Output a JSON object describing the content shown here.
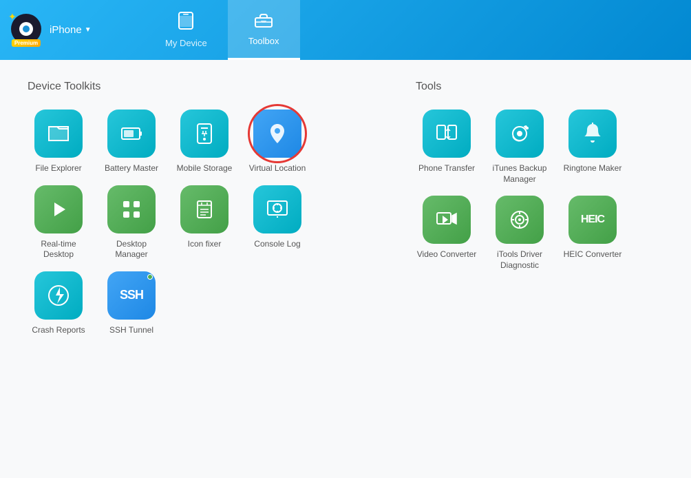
{
  "header": {
    "logo": "👁",
    "device": "iPhone",
    "premium": "Premium",
    "tabs": [
      {
        "id": "my-device",
        "label": "My Device",
        "icon": "📱",
        "active": false
      },
      {
        "id": "toolbox",
        "label": "Toolbox",
        "icon": "🧰",
        "active": true
      }
    ],
    "controls": [
      "☰",
      "—",
      "□",
      "✕"
    ]
  },
  "device_toolkits": {
    "section_title": "Device Toolkits",
    "tools": [
      {
        "id": "file-explorer",
        "label": "File Explorer",
        "icon": "folder",
        "color": "teal"
      },
      {
        "id": "battery-master",
        "label": "Battery Master",
        "icon": "battery",
        "color": "teal"
      },
      {
        "id": "mobile-storage",
        "label": "Mobile Storage",
        "icon": "storage",
        "color": "teal"
      },
      {
        "id": "virtual-location",
        "label": "Virtual Location",
        "icon": "location",
        "color": "blue-outlined"
      },
      {
        "id": "real-time-desktop",
        "label": "Real-time Desktop",
        "icon": "play",
        "color": "green"
      },
      {
        "id": "desktop-manager",
        "label": "Desktop Manager",
        "icon": "grid",
        "color": "green"
      },
      {
        "id": "icon-fixer",
        "label": "Icon fixer",
        "icon": "trash",
        "color": "green"
      },
      {
        "id": "console-log",
        "label": "Console Log",
        "icon": "clock-screen",
        "color": "teal"
      },
      {
        "id": "crash-reports",
        "label": "Crash Reports",
        "icon": "lightning",
        "color": "teal"
      },
      {
        "id": "ssh-tunnel",
        "label": "SSH Tunnel",
        "icon": "ssh",
        "color": "blue",
        "dot": true
      }
    ]
  },
  "tools": {
    "section_title": "Tools",
    "items": [
      {
        "id": "phone-transfer",
        "label": "Phone Transfer",
        "icon": "transfer",
        "color": "teal"
      },
      {
        "id": "itunes-backup-manager",
        "label": "iTunes Backup Manager",
        "icon": "music",
        "color": "teal"
      },
      {
        "id": "ringtone-maker",
        "label": "Ringtone Maker",
        "icon": "bell",
        "color": "teal"
      },
      {
        "id": "video-converter",
        "label": "Video Converter",
        "icon": "video",
        "color": "green"
      },
      {
        "id": "itools-driver-diagnostic",
        "label": "iTools Driver Diagnostic",
        "icon": "diagnostic",
        "color": "green"
      },
      {
        "id": "heic-converter",
        "label": "HEIC Converter",
        "icon": "heic",
        "color": "green"
      }
    ]
  }
}
